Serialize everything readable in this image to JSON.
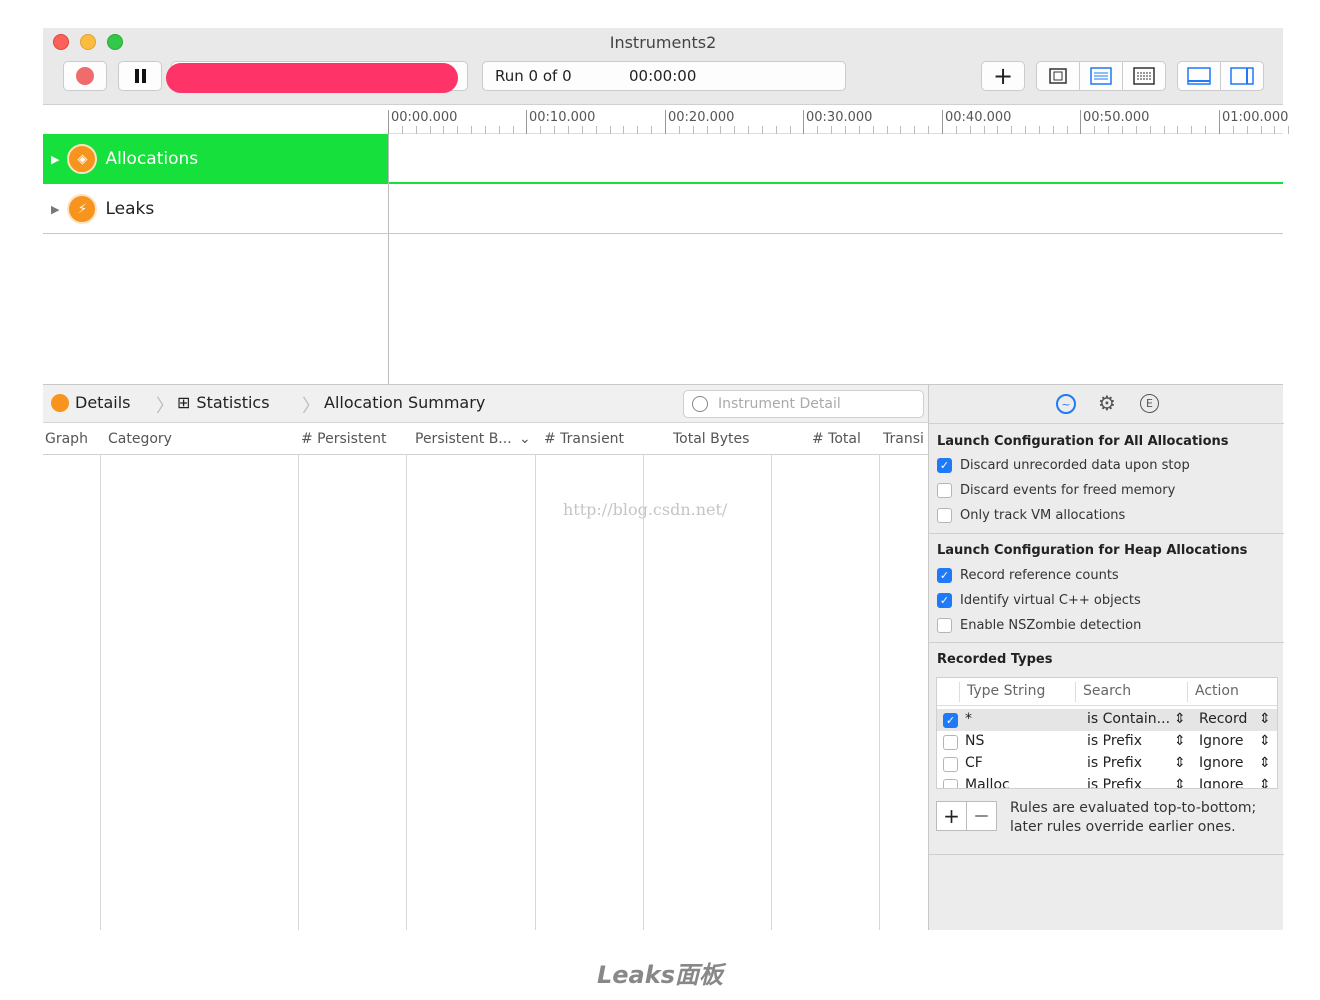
{
  "window": {
    "title": "Instruments2",
    "run_label": "Run 0 of 0",
    "timer": "00:00:00",
    "add_label": "+"
  },
  "ruler_ticks": [
    "00:00.000",
    "00:10.000",
    "00:20.000",
    "00:30.000",
    "00:40.000",
    "00:50.000",
    "01:00.000"
  ],
  "tracks": [
    {
      "name": "Allocations",
      "selected": true
    },
    {
      "name": "Leaks",
      "selected": false
    }
  ],
  "jumpbar": {
    "details": "Details",
    "statistics": "Statistics",
    "summary": "Allocation Summary",
    "search_placeholder": "Instrument Detail"
  },
  "columns": [
    "Graph",
    "Category",
    "# Persistent",
    "Persistent B...",
    "# Transient",
    "Total Bytes",
    "# Total",
    "Transi"
  ],
  "watermark": "http://blog.csdn.net/",
  "inspector": {
    "section1": {
      "title": "Launch Configuration for All Allocations",
      "options": [
        {
          "label": "Discard unrecorded data upon stop",
          "checked": true
        },
        {
          "label": "Discard events for freed memory",
          "checked": false
        },
        {
          "label": "Only track VM allocations",
          "checked": false
        }
      ]
    },
    "section2": {
      "title": "Launch Configuration for Heap Allocations",
      "options": [
        {
          "label": "Record reference counts",
          "checked": true
        },
        {
          "label": "Identify virtual C++ objects",
          "checked": true
        },
        {
          "label": "Enable NSZombie detection",
          "checked": false
        }
      ]
    },
    "recorded": {
      "title": "Recorded Types",
      "headers": [
        "Type String",
        "Search",
        "Action"
      ],
      "rows": [
        {
          "checked": true,
          "type": "*",
          "search": "is Contain...",
          "action": "Record"
        },
        {
          "checked": false,
          "type": "NS",
          "search": "is Prefix",
          "action": "Ignore"
        },
        {
          "checked": false,
          "type": "CF",
          "search": "is Prefix",
          "action": "Ignore"
        },
        {
          "checked": false,
          "type": "Malloc",
          "search": "is Prefix",
          "action": "Ignore"
        }
      ],
      "plus": "+",
      "minus": "—",
      "note_line1": "Rules are evaluated top-to-bottom;",
      "note_line2": "later rules override earlier ones."
    }
  },
  "caption": "Leaks面板",
  "colors": {
    "selected_track": "#16e03c",
    "accent": "#1f7af8",
    "redaction": "#fe3367",
    "instrument_icon": "#f7941d"
  },
  "icons": [
    "record-icon",
    "pause-icon",
    "plus-icon",
    "cpu-icon",
    "list-icon",
    "grid-icon",
    "bottom-panel-icon",
    "side-panel-icon",
    "triangle-right-icon",
    "allocations-icon",
    "leaks-icon",
    "statistics-grid-icon",
    "search-icon",
    "record-settings-icon",
    "gear-icon",
    "extended-detail-icon",
    "checkmark-icon",
    "stepper-icon"
  ]
}
